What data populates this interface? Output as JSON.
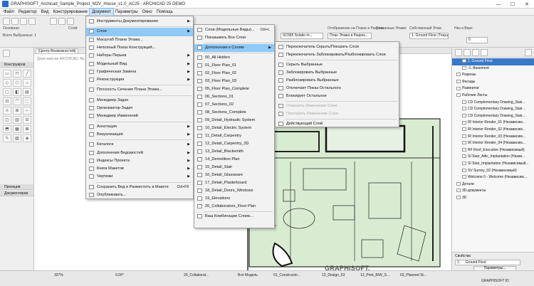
{
  "window": {
    "title": "GRAPHISOFT_Archicad_Sample_Project_M2V_House_v1.0_AC25 - ARCHICAD 25 DEMO",
    "controls": [
      "—",
      "☐",
      "✕"
    ]
  },
  "menubar": {
    "items": [
      "Файл",
      "Редактор",
      "Вид",
      "Конструирование",
      "Документ",
      "Параметры",
      "Окно",
      "Помощь"
    ],
    "active": "Документ"
  },
  "infobox": {
    "groups": [
      {
        "label": "Основная",
        "value": ""
      },
      {
        "label": "Слой:",
        "value": ""
      },
      {
        "label": "Отображение на Плане и Разрезе",
        "value": "План Этажа и Разрез..."
      },
      {
        "label": "Связанные Этажи:",
        "value": ""
      },
      {
        "label": "Собственный Этаж:",
        "value": "1. Ground Floor (Текущий"
      },
      {
        "label": "Низ и Верх",
        "value": "0"
      }
    ],
    "selected_label": "Всего Выбранных: 1",
    "layer_value": "SC565 Solatio m...",
    "floor_text": "1. Ground Floor"
  },
  "toolbox": {
    "headers": [
      "Конструиров",
      "Проекции",
      "Документиров"
    ],
    "tools": [
      "▭",
      "⊓",
      "╱",
      "◇",
      "⬡",
      "⌂",
      "▢",
      "◧",
      "▤",
      "⊡",
      "⌒",
      "⬚",
      "≡",
      "⊞",
      "⌐",
      "◫",
      "▥",
      "⊟",
      "⬒",
      "▦",
      "⊠",
      "✎",
      "▧",
      "◈"
    ]
  },
  "canvas": {
    "tab_label": "[Центр Возможностей]",
    "demo_text": "Демо-версия ARCHICAD. Ву...",
    "watermark": "GRAPHISOFT."
  },
  "document_menu": {
    "items": [
      {
        "label": "Инструменты Документирования",
        "submenu": true
      },
      {
        "label": "Слои",
        "submenu": true,
        "highlighted": true
      },
      {
        "label": "Масштаб Плана Этажа..."
      },
      {
        "label": "Неполный Показ Конструкций..."
      },
      {
        "label": "Наборы Перьев",
        "submenu": true
      },
      {
        "label": "Модельный Вид",
        "submenu": true
      },
      {
        "label": "Графическая Замена",
        "submenu": true
      },
      {
        "label": "Реконструкция",
        "submenu": true
      },
      {
        "label": "Плоскость Сечения Плана Этажа..."
      },
      {
        "label": "Менеджер Задач"
      },
      {
        "label": "Организатор Задач"
      },
      {
        "label": "Менеджер Изменений"
      },
      {
        "label": "Аннотация",
        "submenu": true
      },
      {
        "label": "Визуализация",
        "submenu": true
      },
      {
        "label": "Каталоги",
        "submenu": true
      },
      {
        "label": "Дополнения Ведомостей",
        "submenu": true
      },
      {
        "label": "Индексы Проекта",
        "submenu": true
      },
      {
        "label": "Книга Макетов",
        "submenu": true
      },
      {
        "label": "Чертежи",
        "submenu": true
      },
      {
        "label": "Сохранить Вид и Разместить в Макете",
        "shortcut": "Ctrl+F8"
      },
      {
        "label": "Опубликовать..."
      }
    ]
  },
  "layers_menu": {
    "items": [
      {
        "label": "Слои (Модельные Виды)...",
        "shortcut": "Ctrl+L"
      },
      {
        "label": "Показывать Все Слои"
      },
      {
        "label": "Дополнения к Слоям",
        "submenu": true,
        "highlighted": true
      },
      {
        "label": "00_All Hidden"
      },
      {
        "label": "01_Floor Plan_01"
      },
      {
        "label": "02_Floor Plan_02"
      },
      {
        "label": "03_Floor Plan_03"
      },
      {
        "label": "05_Floor Plan_Complete"
      },
      {
        "label": "06_Sections_01"
      },
      {
        "label": "07_Sections_02"
      },
      {
        "label": "08_Sections_Complete"
      },
      {
        "label": "09_Detail_Hydraulic System"
      },
      {
        "label": "10_Detail_Electric System"
      },
      {
        "label": "11_Detail_Carpentry"
      },
      {
        "label": "12_Detail_Carpentry_3D"
      },
      {
        "label": "13_Detail_Blacksmith"
      },
      {
        "label": "14_Demolition Plan"
      },
      {
        "label": "15_Detail_Stair"
      },
      {
        "label": "16_Detail_Glassware"
      },
      {
        "label": "17_Detail_Plasterboard"
      },
      {
        "label": "18_Detail_Doors_Windows"
      },
      {
        "label": "19_Elevations"
      },
      {
        "label": "20_Collaborators_Floor Plan",
        "checked": true
      },
      {
        "label": "Ваш Комбинации Слоев..."
      }
    ]
  },
  "extras_menu": {
    "items": [
      {
        "label": "Переключатель Скрыть/Показать Слои"
      },
      {
        "label": "Переключатель Заблокировать/Разблокировать Слои"
      },
      {
        "label": "Скрыть Выбранные"
      },
      {
        "label": "Заблокировать Выбранные"
      },
      {
        "label": "Разблокировать Выбранные"
      },
      {
        "label": "Отключает Показ Остального"
      },
      {
        "label": "Блокирует Остальное"
      },
      {
        "label": "Отменить Изменение Слоя",
        "disabled": true
      },
      {
        "label": "Повторить Изменение Слоя",
        "disabled": true
      },
      {
        "label": "Действующий Слой"
      }
    ]
  },
  "navigator": {
    "items": [
      {
        "label": "1. Ground Floor",
        "selected": true,
        "indent": 1
      },
      {
        "label": "-1. Basement",
        "indent": 1
      },
      {
        "label": "Разрезы",
        "indent": 0
      },
      {
        "label": "Фасады",
        "indent": 0
      },
      {
        "label": "Развертки",
        "indent": 0
      },
      {
        "label": "Рабочие Листы",
        "indent": 0
      },
      {
        "label": "CD Complementary Drawing_Stair...",
        "indent": 1
      },
      {
        "label": "CD Complementary Drawing_Stair...",
        "indent": 1
      },
      {
        "label": "CD Complementary Drawing_Stair...",
        "indent": 1
      },
      {
        "label": "IR Interior Render_01 (Независим...",
        "indent": 1
      },
      {
        "label": "IR Interior Render_02 (Независим...",
        "indent": 1
      },
      {
        "label": "IR Interior Render_03 (Независим...",
        "indent": 1
      },
      {
        "label": "IR Interior Render_04 (Независим...",
        "indent": 1
      },
      {
        "label": "RF Roof_Executive (Независимый)",
        "indent": 1
      },
      {
        "label": "SI Stair_Attic_Implantation (Незав...",
        "indent": 1
      },
      {
        "label": "SI Stair_Implantation (Независимый...",
        "indent": 1
      },
      {
        "label": "SV Survey_02 (Независимый)",
        "indent": 1
      },
      {
        "label": "Welcome 0 - Welcome (Независим...",
        "indent": 1
      },
      {
        "label": "Детали",
        "indent": 0
      },
      {
        "label": "3D-документы",
        "indent": 0
      },
      {
        "label": "3D",
        "indent": 0
      }
    ],
    "properties_title": "Свойства",
    "properties_floor_num": "1.",
    "properties_floor_name": "Ground Floor",
    "properties_button": "Параметры...",
    "brand": "GRAPHISOFT ID"
  },
  "statusbar": {
    "fields": [
      "327%",
      "0.00°",
      "20_Collaborat...",
      "Вся Модель",
      "01_Constructio...",
      "13_Design_03",
      "13_Print_B/W_S...",
      "03_Planned St..."
    ]
  }
}
